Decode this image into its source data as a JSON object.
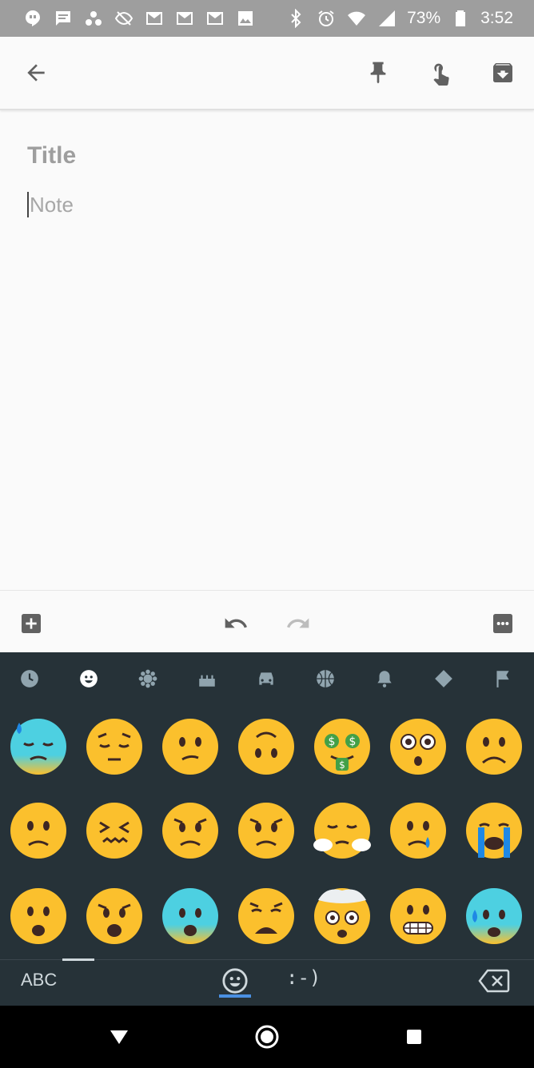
{
  "status_bar": {
    "battery_percent": "73%",
    "time": "3:52",
    "left_icons": [
      "hangouts-icon",
      "message-icon",
      "dots-icon",
      "eye-off-icon",
      "gmail-icon",
      "gmail-icon",
      "gmail-icon",
      "image-icon"
    ],
    "right_icons": [
      "bluetooth-icon",
      "alarm-icon",
      "wifi-icon",
      "signal-icon",
      "battery-icon"
    ]
  },
  "appbar": {
    "icons": [
      "back-arrow-icon",
      "pin-icon",
      "touch-reminder-icon",
      "archive-icon"
    ]
  },
  "note": {
    "title_placeholder": "Title",
    "body_placeholder": "Note"
  },
  "edit_toolbar": {
    "icons": [
      "add-box-icon",
      "undo-icon",
      "redo-icon",
      "more-options-icon"
    ]
  },
  "keyboard": {
    "categories": [
      "recent-icon",
      "smiley-icon",
      "nature-icon",
      "food-icon",
      "car-icon",
      "sports-icon",
      "bell-icon",
      "symbols-icon",
      "flag-icon"
    ],
    "selected_category": "smiley-icon",
    "emojis": [
      [
        "😓",
        "😔",
        "😕",
        "🙃",
        "🤑",
        "😳",
        "☹️"
      ],
      [
        "🙁",
        "😖",
        "😟",
        "😟",
        "😤",
        "😢",
        "😭"
      ],
      [
        "😦",
        "😧",
        "😨",
        "😩",
        "🤯",
        "😬",
        "😰"
      ]
    ],
    "abc_label": "ABC",
    "emoticon_label": ":-)"
  },
  "colors": {
    "statusbar": "#9e9e9e",
    "keyboard_bg": "#263238",
    "accent": "#4a90e2",
    "emoji_yellow": "#fbc02d"
  }
}
